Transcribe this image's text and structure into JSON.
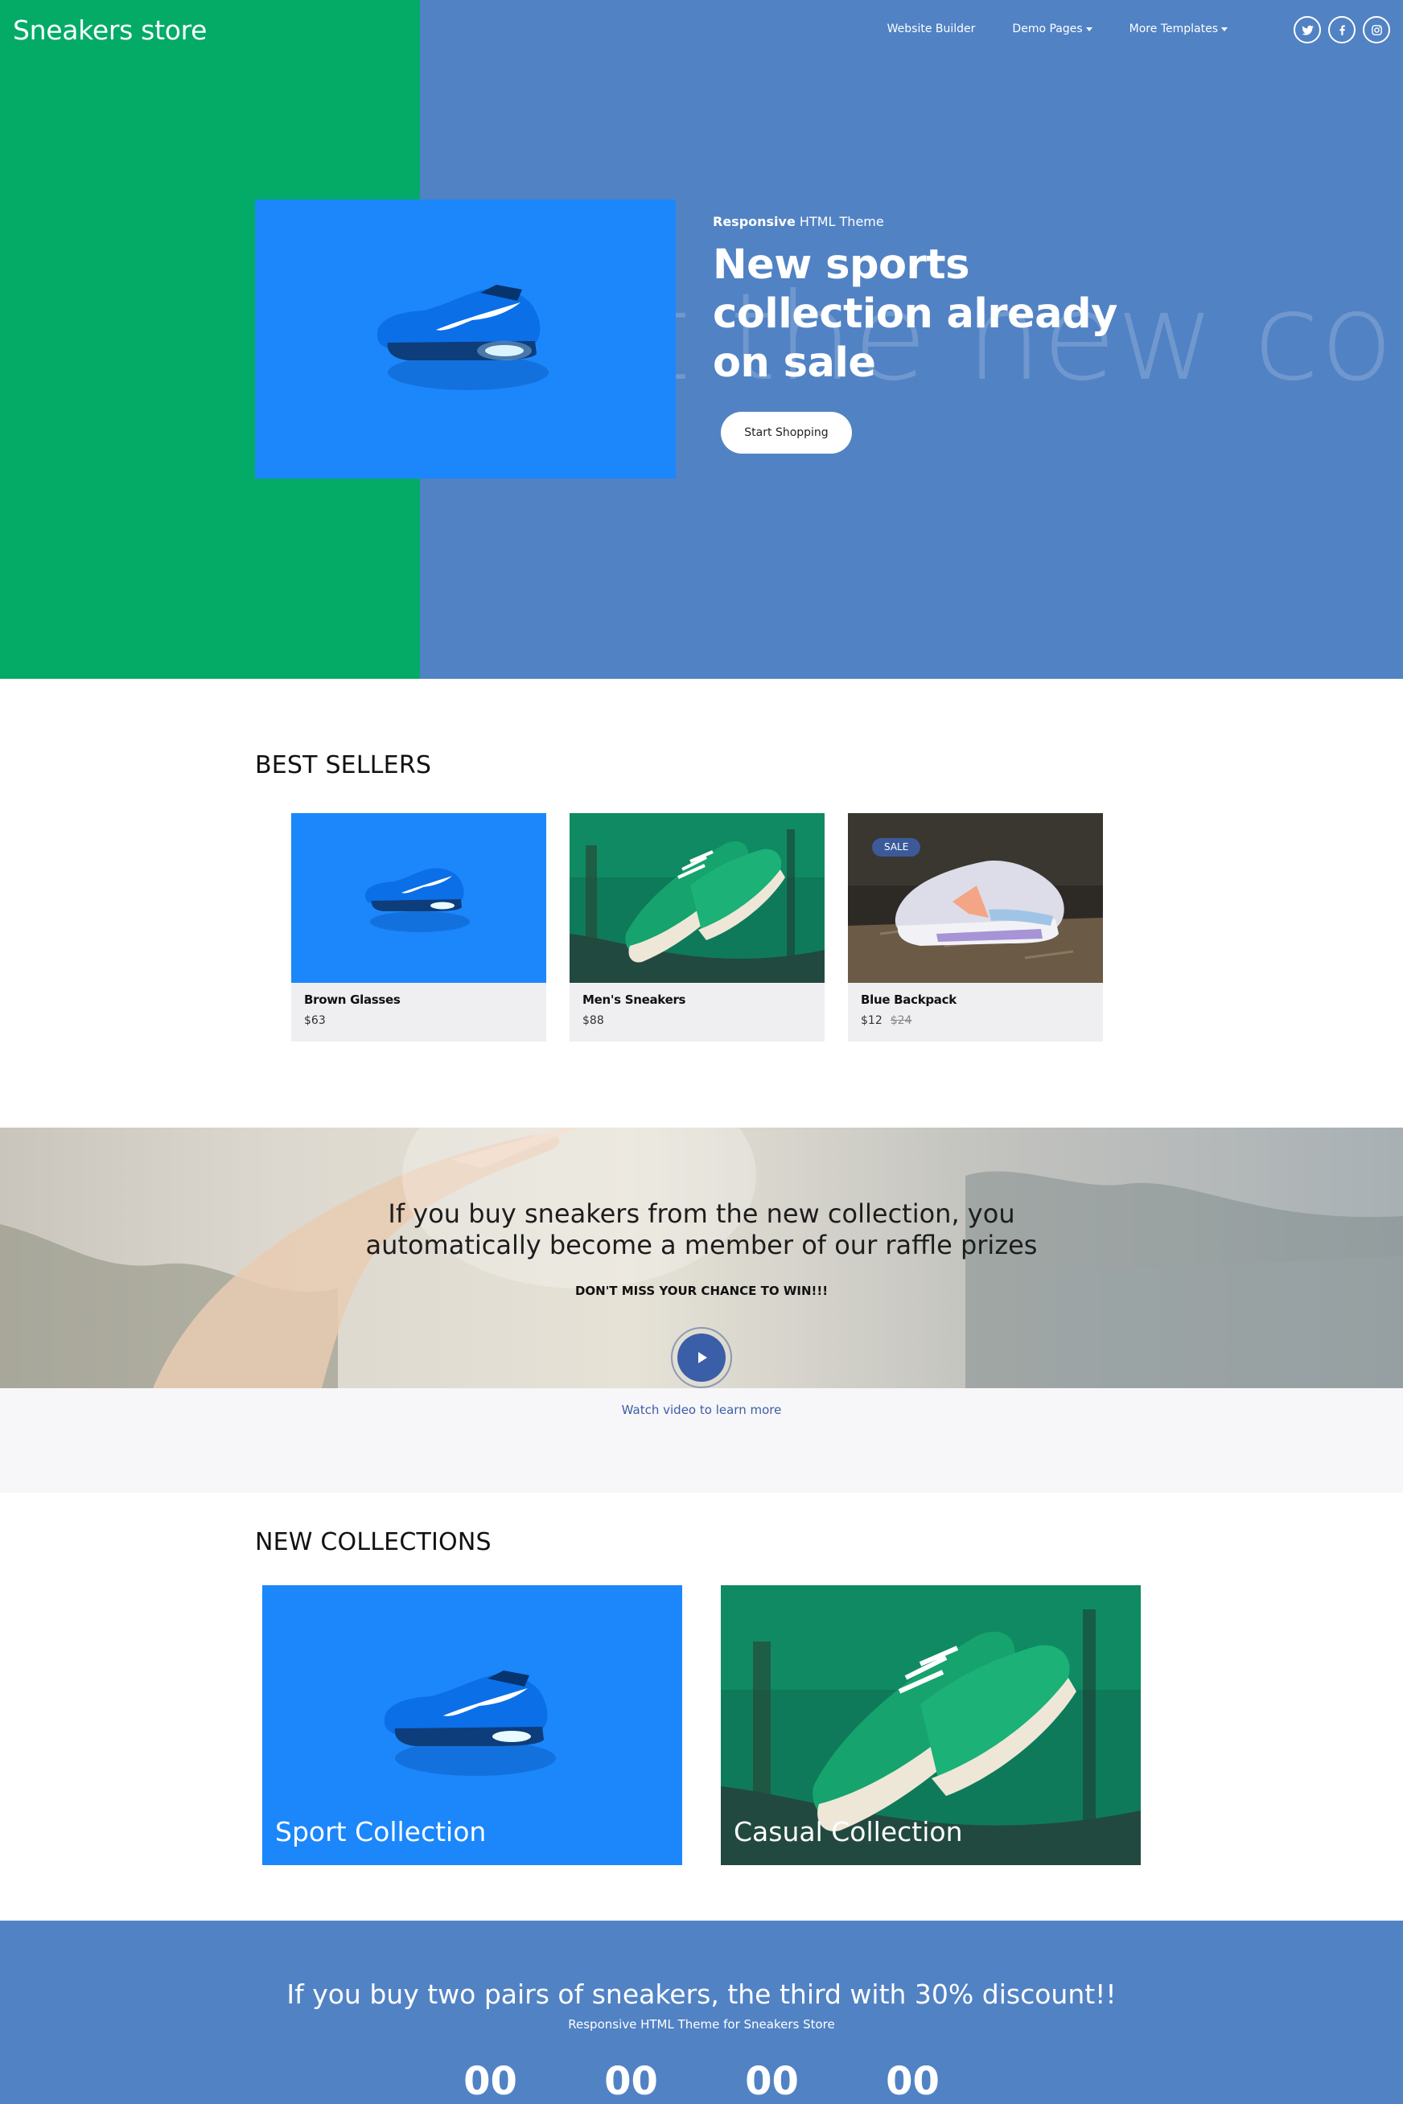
{
  "header": {
    "brand": "Sneakers store",
    "nav": [
      {
        "label": "Website Builder"
      },
      {
        "label": "Demo Pages"
      },
      {
        "label": "More Templates"
      }
    ]
  },
  "hero": {
    "bg_text": "t the new co",
    "kicker_bold": "Responsive",
    "kicker_rest": " HTML Theme",
    "title_lines": [
      "New sports",
      "collection already",
      "on sale"
    ],
    "cta": "Start Shopping"
  },
  "best_sellers": {
    "title": "BEST SELLERS",
    "items": [
      {
        "name": "Brown Glasses",
        "price": "$63",
        "old_price": "",
        "badge": ""
      },
      {
        "name": "Men's Sneakers",
        "price": "$88",
        "old_price": "",
        "badge": ""
      },
      {
        "name": "Blue Backpack",
        "price": "$12",
        "old_price": "$24",
        "badge": "SALE"
      }
    ]
  },
  "raffle": {
    "line1": "If you buy sneakers from the new collection, you",
    "line2": "automatically become a member of our raffle prizes",
    "subtitle": "DON'T MISS YOUR CHANCE TO WIN!!!",
    "watch": "Watch video to learn more"
  },
  "collections": {
    "title": "NEW COLLECTIONS",
    "items": [
      {
        "label": "Sport Collection"
      },
      {
        "label": "Casual Collection"
      }
    ]
  },
  "promo": {
    "title": "If you buy two pairs of sneakers, the third with 30% discount!!",
    "subtitle": "Responsive HTML Theme for Sneakers Store",
    "countdown": [
      "00",
      "00",
      "00",
      "00"
    ]
  },
  "colors": {
    "hero_blue": "#5182c4",
    "hero_green": "#03ab67",
    "product_blue": "#1b87fb",
    "accent": "#3a5ea8"
  }
}
